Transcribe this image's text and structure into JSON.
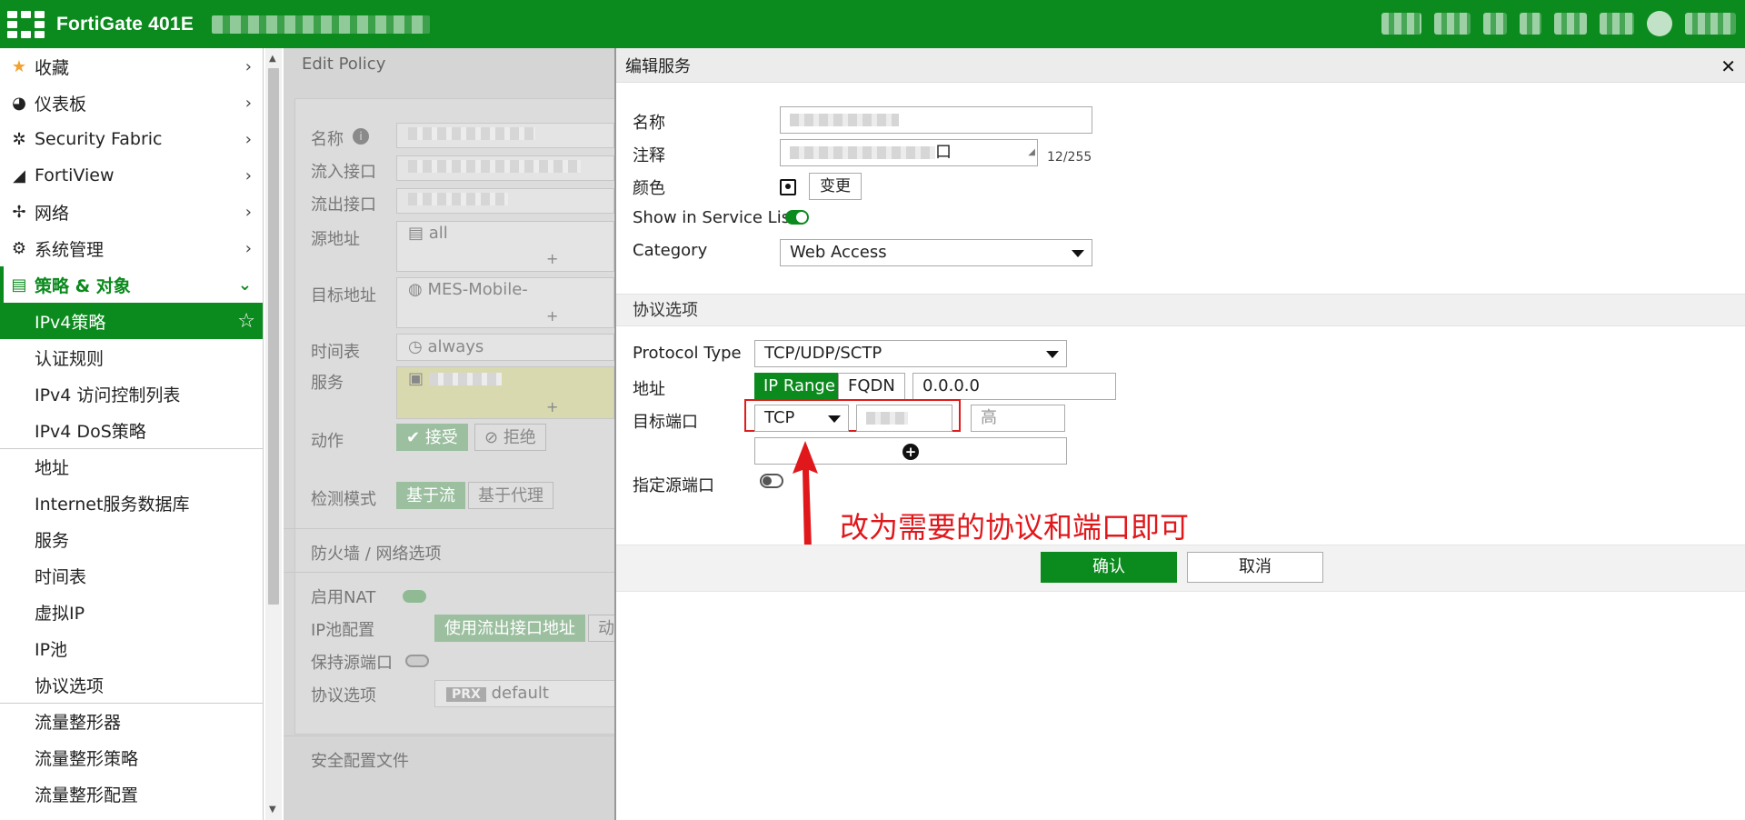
{
  "topbar": {
    "product": "FortiGate 401E"
  },
  "sidebar": {
    "items": [
      {
        "label": "收藏",
        "icon": "star-icon",
        "glyph": "★",
        "color": "#f2a230"
      },
      {
        "label": "仪表板",
        "icon": "dashboard-icon",
        "glyph": "◕"
      },
      {
        "label": "Security Fabric",
        "icon": "fabric-icon",
        "glyph": "✲"
      },
      {
        "label": "FortiView",
        "icon": "chart-icon",
        "glyph": "◢"
      },
      {
        "label": "网络",
        "icon": "network-icon",
        "glyph": "✢"
      },
      {
        "label": "系统管理",
        "icon": "gear-icon",
        "glyph": "⚙"
      },
      {
        "label": "策略 & 对象",
        "icon": "policy-icon",
        "glyph": "▤"
      }
    ],
    "subitems": [
      "IPv4策略",
      "认证规则",
      "IPv4 访问控制列表",
      "IPv4 DoS策略",
      "地址",
      "Internet服务数据库",
      "服务",
      "时间表",
      "虚拟IP",
      "IP池",
      "协议选项",
      "流量整形器",
      "流量整形策略",
      "流量整形配置"
    ]
  },
  "policy": {
    "title": "Edit Policy",
    "labels": {
      "name": "名称",
      "in_if": "流入接口",
      "out_if": "流出接口",
      "src": "源地址",
      "dst": "目标地址",
      "schedule": "时间表",
      "service": "服务",
      "action": "动作",
      "inspect": "检测模式",
      "fw_section": "防火墙 / 网络选项",
      "nat": "启用NAT",
      "ippool": "IP池配置",
      "keep_src": "保持源端口",
      "proto_opt": "协议选项",
      "sec_profile": "安全配置文件"
    },
    "values": {
      "src": "all",
      "dst": "MES-Mobile-",
      "schedule": "always",
      "accept": "接受",
      "deny": "拒绝",
      "flow": "基于流",
      "proxy": "基于代理",
      "use_out_if": "使用流出接口地址",
      "dyn": "动",
      "prx": "PRX",
      "proto_default": "default",
      "plus": "+"
    }
  },
  "service_panel": {
    "title": "编辑服务",
    "close": "✕",
    "labels": {
      "name": "名称",
      "comment": "注释",
      "color": "颜色",
      "show_in_list": "Show in Service List",
      "category": "Category",
      "protocol_section": "协议选项",
      "protocol_type": "Protocol Type",
      "address": "地址",
      "dst_port": "目标端口",
      "specify_src_port": "指定源端口"
    },
    "comment_count": "12/255",
    "comment_tail": "口",
    "change_button": "变更",
    "category_value": "Web Access",
    "protocol_type_value": "TCP/UDP/SCTP",
    "address_modes": [
      "IP Range",
      "FQDN"
    ],
    "address_value": "0.0.0.0",
    "port_protocol": "TCP",
    "port_high_placeholder": "高",
    "add_glyph": "+",
    "annotation": "改为需要的协议和端口即可",
    "ok": "确认",
    "cancel": "取消"
  }
}
